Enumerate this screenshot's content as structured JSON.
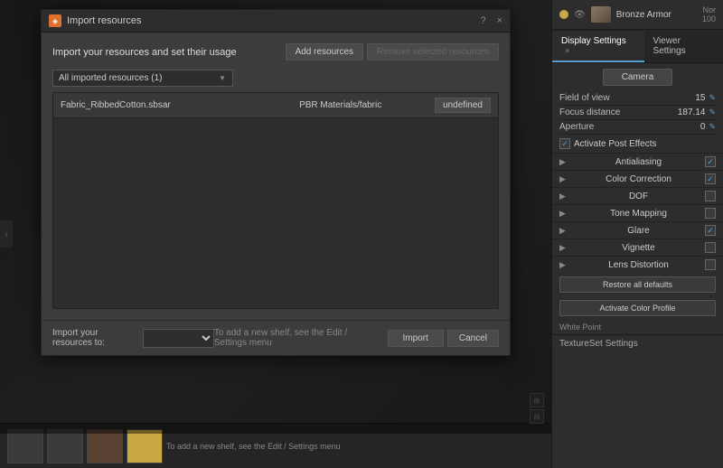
{
  "app": {
    "title": "Import resources"
  },
  "dialog": {
    "title": "Import resources",
    "icon": "◈",
    "help": "?",
    "close": "×",
    "header_title": "Import your resources and set their usage",
    "btn_add": "Add resources",
    "btn_remove": "Remove selected resources",
    "filter_label": "All imported resources (1)",
    "resource": {
      "name": "Fabric_RibbedCotton.sbsar",
      "path": "PBR Materials/fabric",
      "usage": "undefined"
    },
    "import_to_label": "Import your resources to:",
    "import_to_value": "",
    "footer_tip": "To add a new shelf, see the Edit / Settings menu",
    "btn_import": "Import",
    "btn_cancel": "Cancel"
  },
  "right_panel": {
    "asset_name": "Bronze Armor",
    "top_right": "Nor\n100",
    "tabs": [
      {
        "label": "Display Settings",
        "active": true,
        "closeable": true
      },
      {
        "label": "Viewer Settings",
        "active": false,
        "closeable": false
      }
    ],
    "camera_btn": "Camera",
    "settings": [
      {
        "label": "Field of view",
        "value": "15",
        "editable": true
      },
      {
        "label": "Focus distance",
        "value": "187.14",
        "editable": true
      },
      {
        "label": "Aperture",
        "value": "0",
        "editable": true
      }
    ],
    "activate_post_effects": {
      "label": "Activate Post Effects",
      "checked": true
    },
    "effects": [
      {
        "label": "Antialiasing",
        "checked": true
      },
      {
        "label": "Color Correction",
        "checked": true
      },
      {
        "label": "DOF",
        "checked": false
      },
      {
        "label": "Tone Mapping",
        "checked": false
      },
      {
        "label": "Glare",
        "checked": true
      },
      {
        "label": "Vignette",
        "checked": false
      },
      {
        "label": "Lens Distortion",
        "checked": false
      }
    ],
    "restore_btn": "Restore all defaults",
    "activate_color_btn": "Activate Color Profile",
    "white_point_label": "White Point",
    "texture_set_label": "TextureSet Settings"
  },
  "bottom": {
    "tip": "To add a new shelf, see the Edit / Settings menu"
  }
}
